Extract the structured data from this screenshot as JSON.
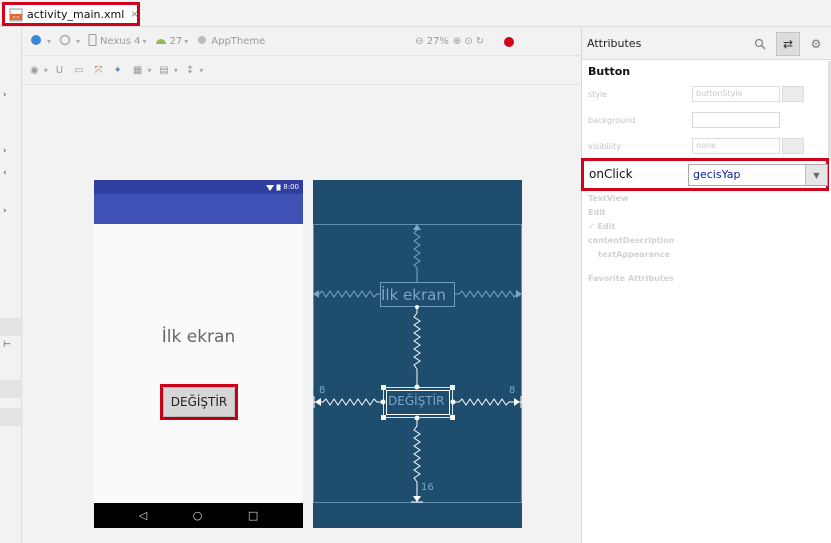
{
  "tab": {
    "label": "activity_main.xml",
    "close": "×"
  },
  "toolbar": {
    "device": "Nexus 4",
    "api": "27",
    "theme": "AppTheme",
    "zoom": "27%"
  },
  "preview": {
    "status_time": "8:00",
    "textview_text": "İlk ekran",
    "button_text": "DEĞİŞTİR",
    "nav_back": "◁",
    "nav_home": "○",
    "nav_recent": "□"
  },
  "blueprint": {
    "textview_text": "İlk ekran",
    "button_text": "DEĞİŞTİR",
    "margin_left": "8",
    "margin_right": "8",
    "margin_bottom": "16"
  },
  "attributes": {
    "title": "Attributes",
    "section": "Button",
    "faded_rows": [
      {
        "label": "style",
        "value": "buttonStyle"
      },
      {
        "label": "background",
        "value": ""
      },
      {
        "label": "visibility",
        "value": "none"
      }
    ],
    "onclick_label": "onClick",
    "onclick_value": "gecisYap",
    "faded_texts": [
      "TextView",
      "Edit",
      "✓ Edit",
      "contentDescription",
      "textAppearance",
      "Favorite Attributes"
    ]
  },
  "colors": {
    "highlight": "#d0021b",
    "status_bar": "#303f9f",
    "app_bar": "#3f51b5",
    "blueprint_bg": "#1f4d6e"
  }
}
